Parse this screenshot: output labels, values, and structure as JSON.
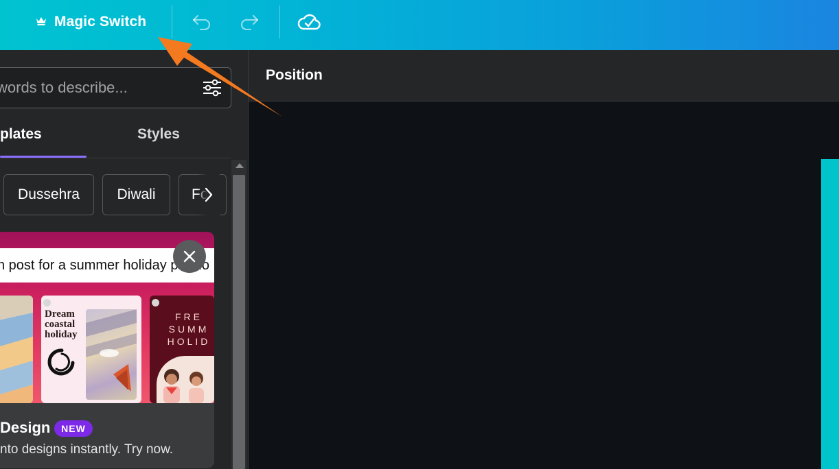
{
  "topbar": {
    "magic_switch_label": "Magic Switch",
    "icons": [
      "crown-icon",
      "undo-icon",
      "redo-icon",
      "cloud-saved-icon"
    ]
  },
  "left_panel": {
    "search_placeholder": "words to describe...",
    "tabs": [
      {
        "label": "plates",
        "active": true
      },
      {
        "label": "Styles",
        "active": false
      }
    ],
    "chips": [
      "Dussehra",
      "Diwali",
      "Fo"
    ],
    "promo": {
      "prompt_text": "n post for a summer holiday promo",
      "thumb_2_text": "Dream coastal holiday",
      "thumb_3_text": "FRE SUMM HOLID",
      "title": "Design",
      "badge": "NEW",
      "description": "nto designs instantly. Try now."
    }
  },
  "editor": {
    "position_title": "Position"
  },
  "colors": {
    "topbar_start": "#00c3d0",
    "topbar_end": "#1a85e0",
    "accent": "#8b70ff",
    "badge": "#7d2ae8",
    "canvas_edge": "#00c4cc",
    "arrow": "#f47a20"
  }
}
